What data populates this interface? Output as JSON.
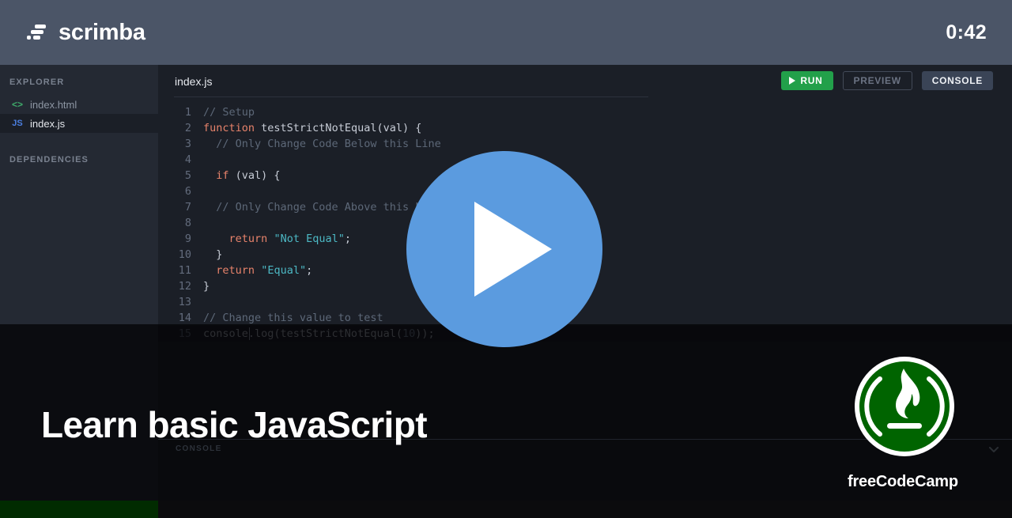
{
  "header": {
    "brand_name": "scrimba",
    "logo_icon": "scrimba-logo-icon",
    "timer": "0:42"
  },
  "sidebar": {
    "explorer_heading": "EXPLORER",
    "dependencies_heading": "DEPENDENCIES",
    "files": [
      {
        "name": "index.html",
        "icon": "html-file-icon",
        "icon_text": "<>",
        "active": false
      },
      {
        "name": "index.js",
        "icon": "js-file-icon",
        "icon_text": "JS",
        "active": true
      }
    ]
  },
  "editor": {
    "tab_label": "index.js",
    "buttons": {
      "run": "RUN",
      "preview": "PREVIEW",
      "console": "CONSOLE"
    },
    "code_lines": [
      {
        "n": "1",
        "text": "// Setup"
      },
      {
        "n": "2",
        "text": "function testStrictNotEqual(val) {"
      },
      {
        "n": "3",
        "text": "  // Only Change Code Below this Line"
      },
      {
        "n": "4",
        "text": ""
      },
      {
        "n": "5",
        "text": "  if (val) {"
      },
      {
        "n": "6",
        "text": ""
      },
      {
        "n": "7",
        "text": "  // Only Change Code Above this Line"
      },
      {
        "n": "8",
        "text": ""
      },
      {
        "n": "9",
        "text": "    return \"Not Equal\";"
      },
      {
        "n": "10",
        "text": "  }"
      },
      {
        "n": "11",
        "text": "  return \"Equal\";"
      },
      {
        "n": "12",
        "text": "}"
      },
      {
        "n": "13",
        "text": ""
      },
      {
        "n": "14",
        "text": "// Change this value to test"
      },
      {
        "n": "15",
        "text": "console.log(testStrictNotEqual(10));"
      }
    ]
  },
  "console_panel": {
    "label": "CONSOLE",
    "collapse_icon": "chevron-down-icon"
  },
  "overlay": {
    "play_icon": "play-button-icon",
    "lesson_title": "Learn basic JavaScript"
  },
  "branding": {
    "fcc_name": "freeCodeCamp",
    "fcc_icon": "freecodecamp-flame-logo-icon"
  },
  "colors": {
    "header_bg": "#4b5567",
    "sidebar_bg": "#242933",
    "editor_bg": "#1b1f27",
    "run_green": "#22a04a",
    "console_active": "#3a4456",
    "play_blue": "#5b9bdf",
    "fcc_green": "#006400",
    "progress_green": "#012b00"
  }
}
